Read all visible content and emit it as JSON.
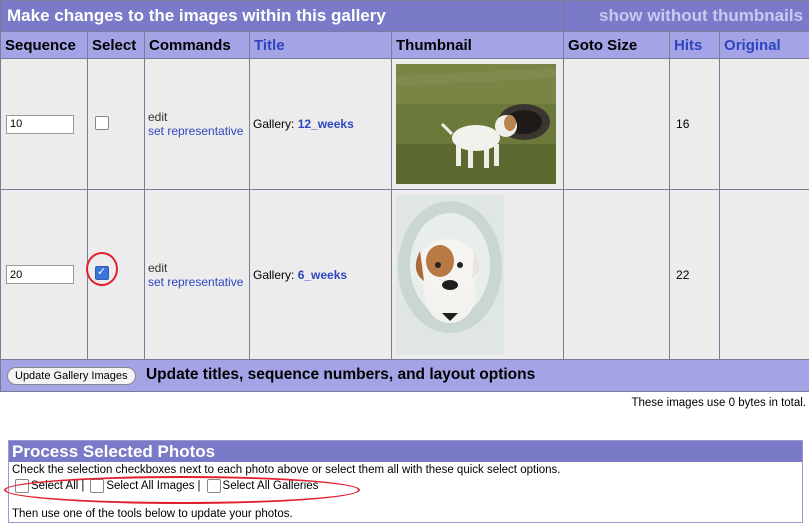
{
  "header": {
    "title": "Make changes to the images within this gallery",
    "toggle_link": "show without thumbnails"
  },
  "columns": {
    "sequence": "Sequence",
    "select": "Select",
    "commands": "Commands",
    "title": "Title",
    "thumbnail": "Thumbnail",
    "goto_size": "Goto Size",
    "hits": "Hits",
    "original": "Original"
  },
  "rows": [
    {
      "sequence": "10",
      "selected": false,
      "edit": "edit",
      "set_representative": "set representative",
      "title_prefix": "Gallery:",
      "gallery_name": "12_weeks",
      "hits": "16",
      "thumbnail": "puppy-grass-photo"
    },
    {
      "sequence": "20",
      "selected": true,
      "edit": "edit",
      "set_representative": "set representative",
      "title_prefix": "Gallery:",
      "gallery_name": "6_weeks",
      "hits": "22",
      "thumbnail": "puppy-blanket-photo"
    }
  ],
  "footer": {
    "update_button": "Update Gallery Images",
    "update_text": "Update titles, sequence numbers, and layout options"
  },
  "usage_text": "These images use 0 bytes in total.",
  "process": {
    "title": "Process Selected Photos",
    "instructions": "Check the selection checkboxes next to each photo above or select them all with these quick select options.",
    "quick_select": [
      "Select All",
      "Select All Images",
      "Select All Galleries"
    ],
    "separator": "|",
    "tail": "Then use one of the tools below to update your photos."
  },
  "colors": {
    "header_bar": "#7a7ac8",
    "column_header": "#a3a3e6",
    "link": "#2e46c0",
    "highlight_circle": "#e0202e"
  }
}
